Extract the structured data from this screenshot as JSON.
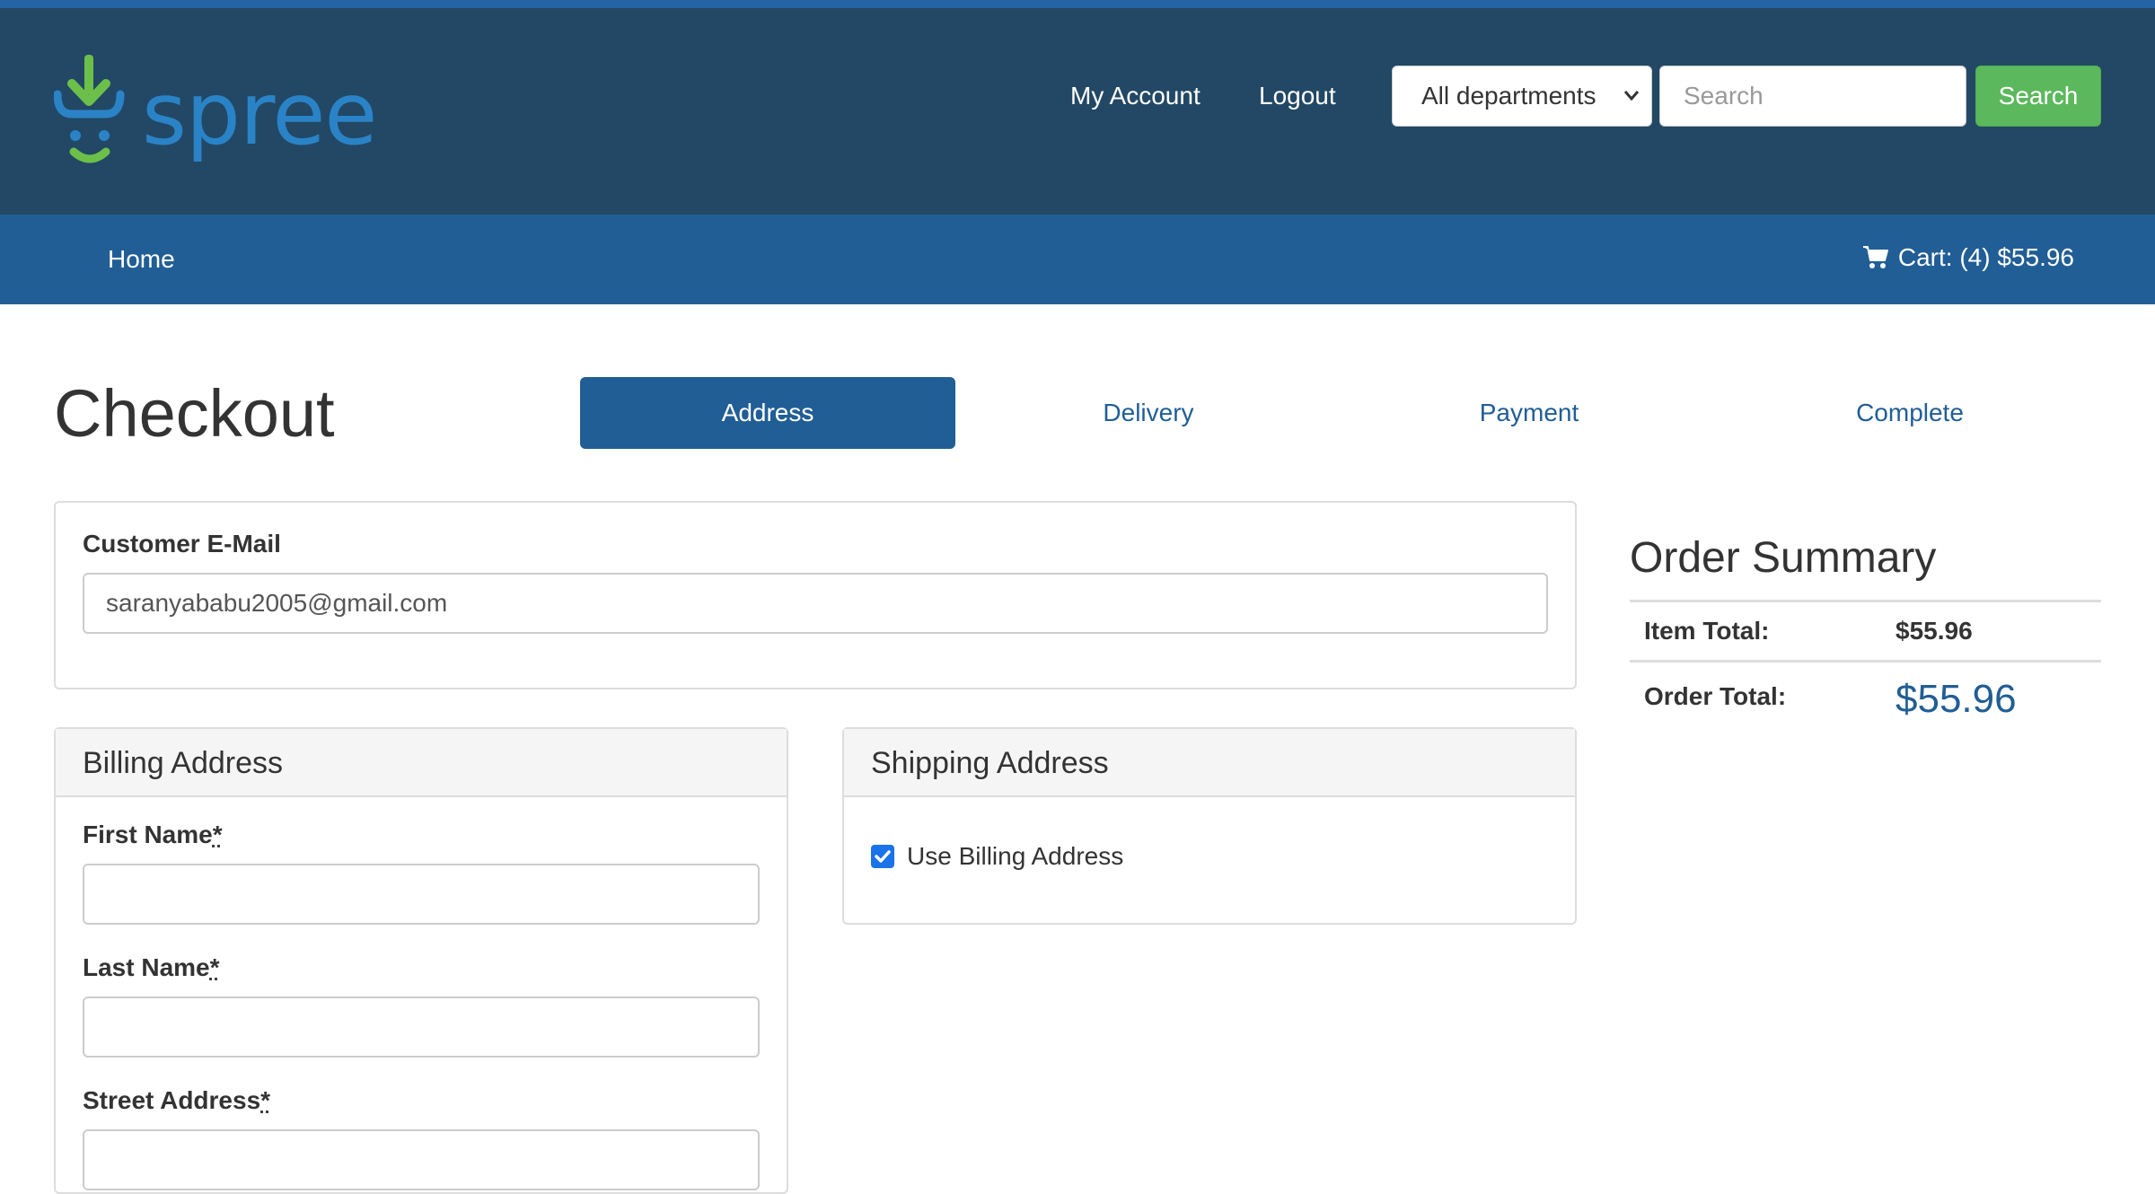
{
  "brand": {
    "name": "spree"
  },
  "header": {
    "links": {
      "account": "My Account",
      "logout": "Logout"
    },
    "department": {
      "selected": "All departments"
    },
    "search": {
      "placeholder": "Search",
      "button": "Search"
    }
  },
  "nav": {
    "home": "Home",
    "cart": "Cart: (4) $55.96"
  },
  "checkout": {
    "title": "Checkout",
    "steps": [
      "Address",
      "Delivery",
      "Payment",
      "Complete"
    ],
    "active_step": "Address"
  },
  "email_panel": {
    "label": "Customer E-Mail",
    "value": "saranyababu2005@gmail.com"
  },
  "billing": {
    "title": "Billing Address",
    "fields": [
      {
        "label": "First Name",
        "required": "*",
        "value": ""
      },
      {
        "label": "Last Name",
        "required": "*",
        "value": ""
      },
      {
        "label": "Street Address",
        "required": "*",
        "value": ""
      }
    ]
  },
  "shipping": {
    "title": "Shipping Address",
    "use_billing_label": "Use Billing Address",
    "use_billing_checked": true
  },
  "summary": {
    "title": "Order Summary",
    "item_total_label": "Item Total:",
    "item_total": "$55.96",
    "order_total_label": "Order Total:",
    "order_total": "$55.96"
  },
  "colors": {
    "header_bg": "#224865",
    "nav_bg": "#215e95",
    "accent": "#215e95",
    "search_btn": "#5cb85c",
    "logo_green": "#6cc04a",
    "logo_blue": "#2a83c6"
  }
}
